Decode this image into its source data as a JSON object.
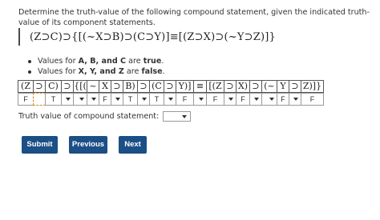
{
  "prompt": "Determine the truth-value of the following compound statement, given the indicated truth-value of its component statements.",
  "formula": "(Z⊃C)⊃{[(~X⊃B)⊃(C⊃Y)]≡[(Z⊃X)⊃(~Y⊃Z)]}",
  "bullets": [
    {
      "prefix": "Values for ",
      "vars": "A, B, and C",
      "suffix": " are ",
      "value": "true",
      "end": "."
    },
    {
      "prefix": "Values for ",
      "vars": "X, Y, and Z",
      "suffix": " are ",
      "value": "false",
      "end": "."
    }
  ],
  "table": {
    "header": [
      "(Z",
      "⊃",
      "C)",
      "⊃",
      "{[(",
      "~",
      "X",
      "⊃",
      "B)",
      "⊃",
      "(C",
      "⊃",
      "Y)]",
      "≡",
      "[(Z",
      "⊃",
      "X)",
      "⊃",
      "(~",
      "Y",
      "⊃",
      "Z)]}"
    ],
    "values": [
      "F",
      "",
      "T",
      "",
      "",
      "",
      "F",
      "",
      "T",
      "",
      "T",
      "",
      "F",
      "",
      "F",
      "",
      "F",
      "",
      "",
      "F",
      "",
      "F"
    ]
  },
  "truth_label": "Truth value of compound statement:",
  "truth_value": "",
  "buttons": {
    "submit": "Submit",
    "previous": "Previous",
    "next": "Next"
  }
}
